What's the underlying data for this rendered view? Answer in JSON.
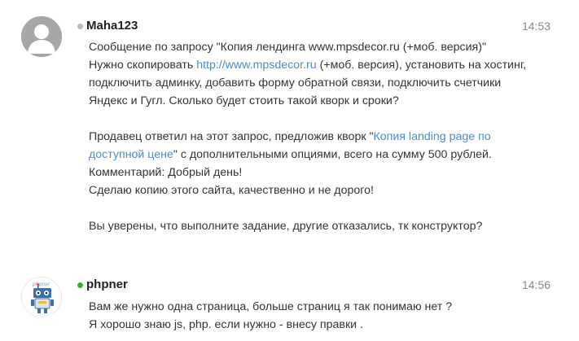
{
  "messages": [
    {
      "username": "Maha123",
      "time": "14:53",
      "status": "offline",
      "lines": {
        "l1": "Сообщение по запросу \"Копия лендинга www.mpsdecor.ru (+моб. версия)\"",
        "l2_pre": "Нужно скопировать ",
        "l2_link": "http://www.mpsdecor.ru",
        "l2_post": " (+моб. версия), установить на хостинг,",
        "l3": "подключить админку, добавить форму обратной связи, подключить счетчики",
        "l4": "Яндекс и Гугл. Сколько будет стоить такой кворк и сроки?",
        "l5_pre": "Продавец ответил на этот запрос, предложив кворк \"",
        "l5_link": "Копия landing page по",
        "l6_link": "доступной цене",
        "l6_post": "\" с дополнительными опциями, всего на сумму 500 рублей.",
        "l7": "Комментарий: Добрый день!",
        "l8": "Сделаю копию этого сайта, качественно и не дорого!",
        "l9": "Вы уверены, что выполните задание, другие отказались, тк конструктор?"
      }
    },
    {
      "username": "phpner",
      "time": "14:56",
      "status": "online",
      "avatar_text": "phpner",
      "lines": {
        "l1": "Вам же нужно одна страница, больше страниц я так понимаю нет ?",
        "l2": "Я хорошо знаю js, php. если нужно - внесу правки ."
      }
    }
  ],
  "colors": {
    "link": "#4a8cce",
    "online": "#2db52d",
    "offline": "#bbbbbb"
  },
  "icons": [
    "default-user-avatar-icon",
    "robot-avatar-icon"
  ]
}
